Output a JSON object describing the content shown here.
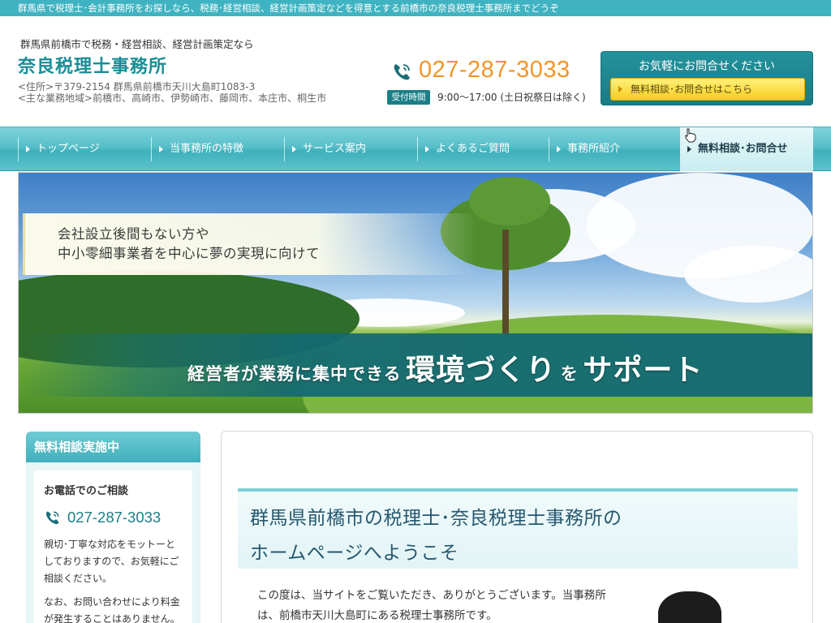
{
  "topbar": {
    "text": "群馬県で税理士･会計事務所をお探しなら、税務･経営相談、経営計画策定などを得意とする前橋市の奈良税理士事務所までどうぞ"
  },
  "header": {
    "tagline": "群馬県前橋市で税務・経営相談、経営計画策定なら",
    "site_title": "奈良税理士事務所",
    "address_line": "<住所>〒379-2154 群馬県前橋市天川大島町1083-3",
    "area_line": "<主な業務地域>前橋市、高崎市、伊勢崎市、藤岡市、本庄市、桐生市",
    "phone": "027-287-3033",
    "hours_badge": "受付時間",
    "hours": "9:00～17:00 (土日祝祭日は除く)",
    "contact_title": "お気軽にお問合せください",
    "contact_button": "無料相談･お問合せはこちら"
  },
  "nav": {
    "items": [
      {
        "label": "トップページ"
      },
      {
        "label": "当事務所の特徴"
      },
      {
        "label": "サービス案内"
      },
      {
        "label": "よくあるご質問"
      },
      {
        "label": "事務所紹介"
      },
      {
        "label": "無料相談･お問合せ"
      }
    ],
    "active_index": 5
  },
  "hero": {
    "text_line1": "会社設立後間もない方や",
    "text_line2": "中小零細事業者を中心に夢の実現に向けて",
    "slogan_part1": "経営者が業務に集中できる",
    "slogan_part2": "環境づくり",
    "slogan_part3": "を",
    "slogan_part4": "サポート"
  },
  "sidebar": {
    "heading": "無料相談実施中",
    "title": "お電話でのご相談",
    "phone": "027-287-3033",
    "text1": "親切･丁寧な対応をモットーとしておりますので、お気軽にご相談ください。",
    "text2": "なお、お問い合わせにより料金が発生することはありません。"
  },
  "main": {
    "title_line1": "群馬県前橋市の税理士･奈良税理士事務所の",
    "title_line2": "ホームページへようこそ",
    "intro": "この度は、当サイトをご覧いただき、ありがとうございます。当事務所は、前橋市天川大島町にある税理士事務所です。"
  },
  "colors": {
    "brand_teal": "#1a8d96",
    "nav_teal": "#3fb0bb",
    "phone_orange": "#f29426",
    "button_yellow": "#f6cc1e"
  },
  "icons": {
    "phone": "phone-icon",
    "cursor": "hand-cursor-icon",
    "nav_arrow": "chevron-right-icon"
  }
}
